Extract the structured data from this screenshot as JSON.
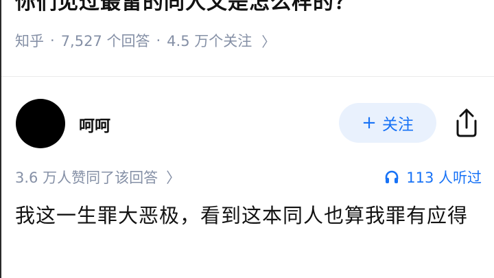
{
  "question": {
    "title": "你们见过最雷的同人文是怎么样的？",
    "source": "知乎",
    "answer_count": "7,527 个回答",
    "follower_count": "4.5 万个关注"
  },
  "author": {
    "name": "呵呵",
    "follow_label": "关注"
  },
  "answer": {
    "upvote_text": "3.6 万人赞同了该回答",
    "listen_text": "113 人听过",
    "content": "我这一生罪大恶极，看到这本同人也算我罪有应得"
  },
  "colors": {
    "accent": "#1772f6",
    "follow_bg": "#e9f1fd",
    "meta_gray": "#8590a6",
    "text": "#121212"
  },
  "icons": {
    "follow": "plus-icon",
    "share": "share-icon",
    "listen": "headphones-icon",
    "more": "chevron-right-icon"
  }
}
